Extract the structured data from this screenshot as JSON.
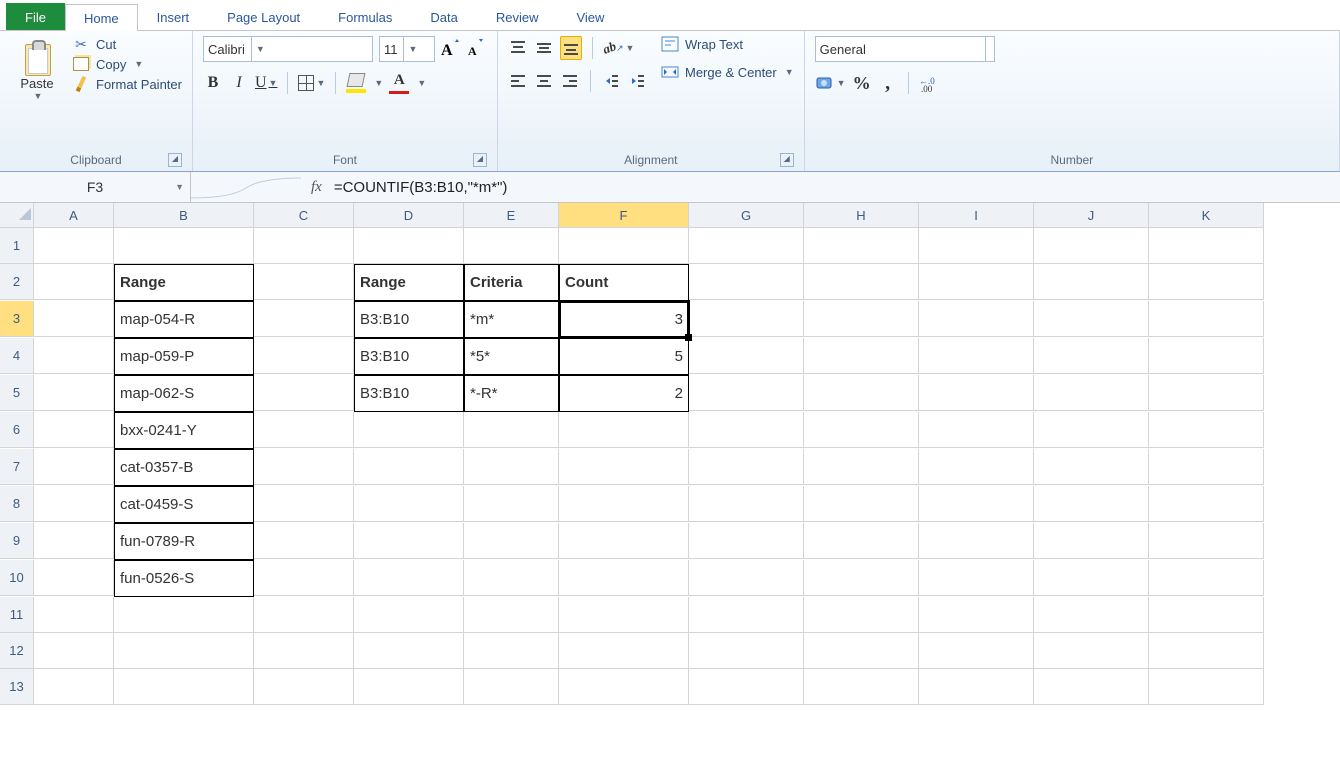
{
  "tabs": {
    "file": "File",
    "home": "Home",
    "insert": "Insert",
    "page_layout": "Page Layout",
    "formulas": "Formulas",
    "data": "Data",
    "review": "Review",
    "view": "View"
  },
  "clipboard": {
    "paste": "Paste",
    "cut": "Cut",
    "copy": "Copy",
    "format_painter": "Format Painter",
    "label": "Clipboard"
  },
  "font": {
    "name": "Calibri",
    "size": "11",
    "label": "Font",
    "bold": "B",
    "italic": "I",
    "underline": "U"
  },
  "alignment": {
    "wrap": "Wrap Text",
    "merge": "Merge & Center",
    "label": "Alignment"
  },
  "number": {
    "format": "General",
    "label": "Number",
    "percent": "%",
    "comma": ","
  },
  "fx": {
    "cell_ref": "F3",
    "symbol": "fx",
    "formula": "=COUNTIF(B3:B10,\"*m*\")"
  },
  "columns": [
    "A",
    "B",
    "C",
    "D",
    "E",
    "F",
    "G",
    "H",
    "I",
    "J",
    "K"
  ],
  "rows": [
    "1",
    "2",
    "3",
    "4",
    "5",
    "6",
    "7",
    "8",
    "9",
    "10",
    "11",
    "12",
    "13"
  ],
  "sheet": {
    "B2": "Range",
    "B3": "map-054-R",
    "B4": "map-059-P",
    "B5": "map-062-S",
    "B6": "bxx-0241-Y",
    "B7": "cat-0357-B",
    "B8": "cat-0459-S",
    "B9": "fun-0789-R",
    "B10": "fun-0526-S",
    "D2": "Range",
    "E2": "Criteria",
    "F2": "Count",
    "D3": "B3:B10",
    "E3": "*m*",
    "F3": "3",
    "D4": "B3:B10",
    "E4": "*5*",
    "F4": "5",
    "D5": "B3:B10",
    "E5": "*-R*",
    "F5": "2"
  },
  "chart_data": {
    "type": "table",
    "source_range": {
      "header": "Range",
      "values": [
        "map-054-R",
        "map-059-P",
        "map-062-S",
        "bxx-0241-Y",
        "cat-0357-B",
        "cat-0459-S",
        "fun-0789-R",
        "fun-0526-S"
      ]
    },
    "results": {
      "columns": [
        "Range",
        "Criteria",
        "Count"
      ],
      "rows": [
        {
          "Range": "B3:B10",
          "Criteria": "*m*",
          "Count": 3
        },
        {
          "Range": "B3:B10",
          "Criteria": "*5*",
          "Count": 5
        },
        {
          "Range": "B3:B10",
          "Criteria": "*-R*",
          "Count": 2
        }
      ]
    },
    "active_cell": "F3",
    "formula": "=COUNTIF(B3:B10,\"*m*\")"
  }
}
